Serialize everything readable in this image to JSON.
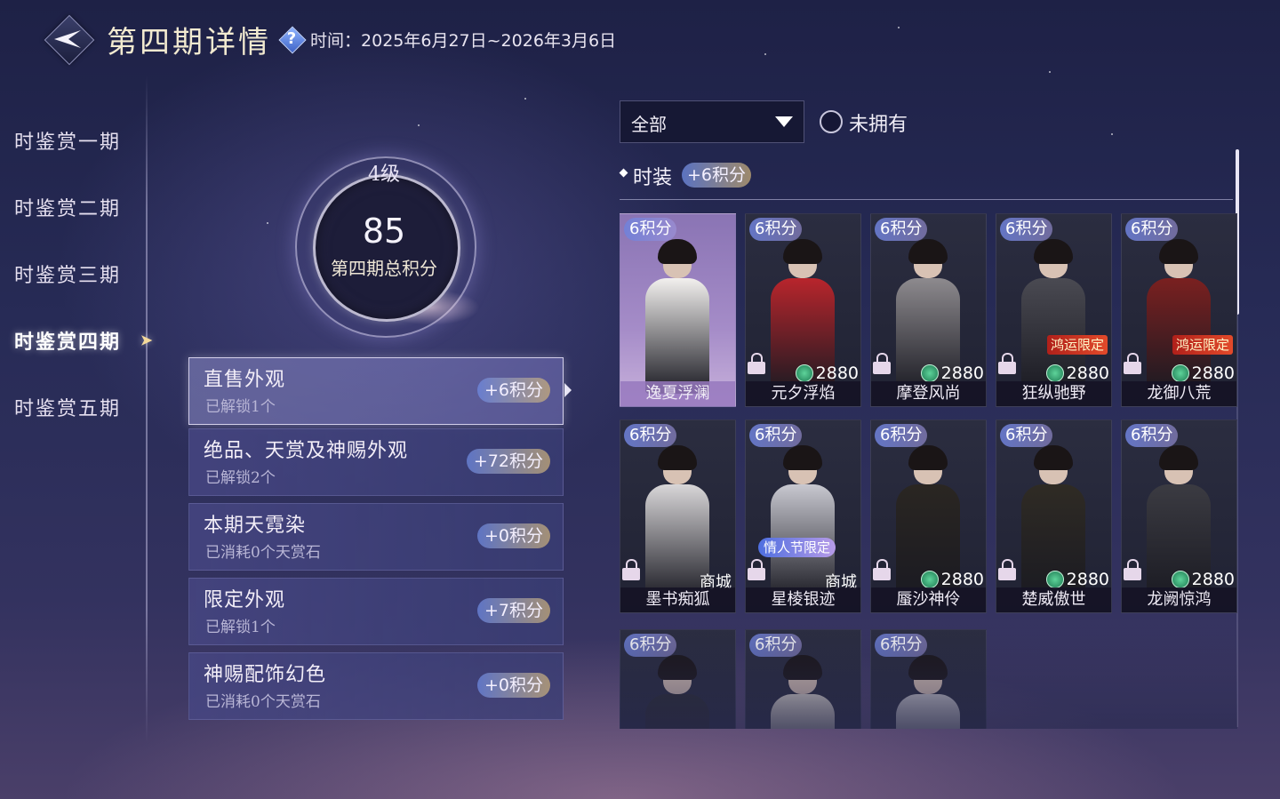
{
  "header": {
    "title": "第四期详情",
    "period_label": "时间：",
    "period_value": "2025年6月27日~2026年3月6日"
  },
  "sidebar": {
    "items": [
      {
        "label": "时鉴赏一期"
      },
      {
        "label": "时鉴赏二期"
      },
      {
        "label": "时鉴赏三期"
      },
      {
        "label": "时鉴赏四期",
        "active": true
      },
      {
        "label": "时鉴赏五期"
      }
    ]
  },
  "score": {
    "level": "4级",
    "total": "85",
    "label": "第四期总积分"
  },
  "categories": [
    {
      "title": "直售外观",
      "sub": "已解锁1个",
      "points": "+6积分",
      "active": true
    },
    {
      "title": "绝品、天赏及神赐外观",
      "sub": "已解锁2个",
      "points": "+72积分"
    },
    {
      "title": "本期天霓染",
      "sub": "已消耗0个天赏石",
      "points": "+0积分"
    },
    {
      "title": "限定外观",
      "sub": "已解锁1个",
      "points": "+7积分"
    },
    {
      "title": "神赐配饰幻色",
      "sub": "已消耗0个天赏石",
      "points": "+0积分"
    }
  ],
  "filter": {
    "selected": "全部",
    "unowned_label": "未拥有"
  },
  "section": {
    "title": "时装",
    "points": "+6积分"
  },
  "cards": [
    {
      "points": "6积分",
      "name": "逸夏浮澜",
      "owned": true,
      "color": "#f2f0ee"
    },
    {
      "points": "6积分",
      "name": "元夕浮焰",
      "price": "2880",
      "color": "#b8252c"
    },
    {
      "points": "6积分",
      "name": "摩登风尚",
      "price": "2880",
      "color": "#8d8a8e"
    },
    {
      "points": "6积分",
      "name": "狂纵驰野",
      "price": "2880",
      "badge": "鸿运限定",
      "color": "#4a4a52"
    },
    {
      "points": "6积分",
      "name": "龙御八荒",
      "price": "2880",
      "badge": "鸿运限定",
      "color": "#7a2020"
    },
    {
      "points": "6积分",
      "name": "墨书痴狐",
      "shop": "商城",
      "color": "#d8d6d8"
    },
    {
      "points": "6积分",
      "name": "星棱银迹",
      "shop": "商城",
      "badge2": "情人节限定",
      "color": "#c8c8d0"
    },
    {
      "points": "6积分",
      "name": "蜃沙神伶",
      "price": "2880",
      "color": "#2a2622"
    },
    {
      "points": "6积分",
      "name": "楚威傲世",
      "price": "2880",
      "color": "#2f2b24"
    },
    {
      "points": "6积分",
      "name": "龙阙惊鸿",
      "price": "2880",
      "color": "#3b3b42"
    },
    {
      "points": "6积分",
      "name": "",
      "color": "#2a2a30"
    },
    {
      "points": "6积分",
      "name": "",
      "color": "#d8d2c8"
    },
    {
      "points": "6积分",
      "name": "",
      "color": "#c8c6c8"
    }
  ]
}
